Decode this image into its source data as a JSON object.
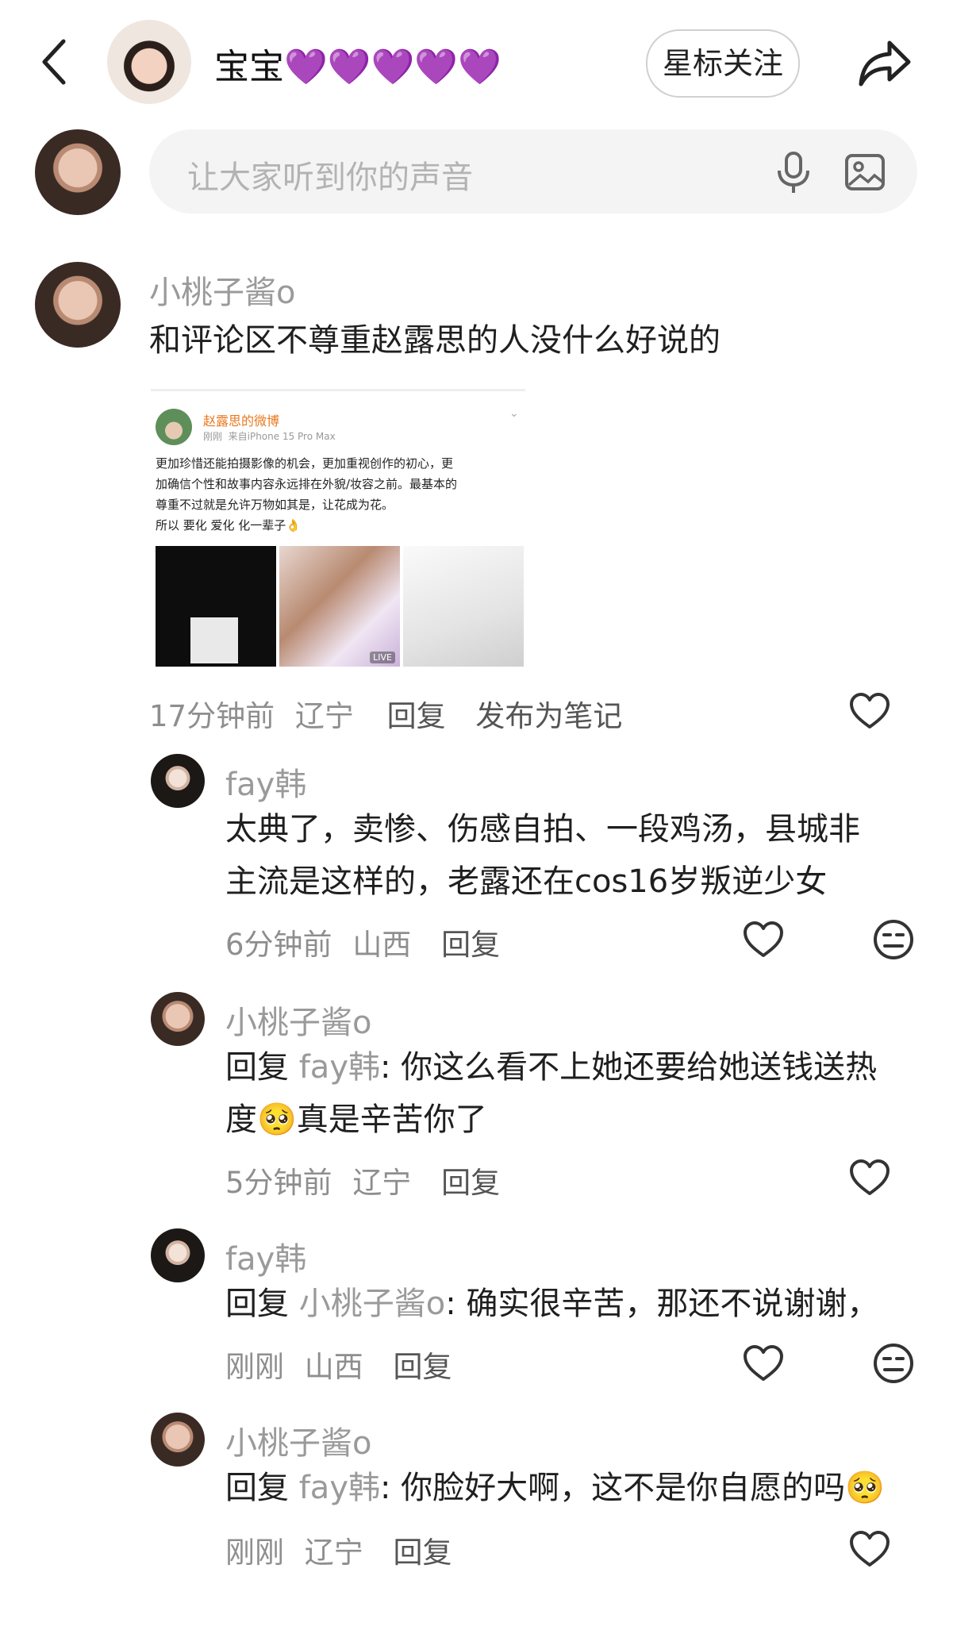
{
  "header": {
    "back_icon": "chevron-left-icon",
    "title": "宝宝💜💜💜💜💜",
    "follow_button": "星标关注",
    "share_icon": "share-arrow-icon"
  },
  "composer": {
    "placeholder": "让大家听到你的声音",
    "mic_icon": "microphone-icon",
    "image_icon": "image-icon"
  },
  "post": {
    "author": "小桃子酱o",
    "text": "和评论区不尊重赵露思的人没什么好说的",
    "screenshot": {
      "weibo_name": "赵露思的微博",
      "weibo_meta": "刚刚  来自iPhone 15 Pro Max",
      "weibo_line1": "更加珍惜还能拍摄影像的机会，更加重视创作的初心，更",
      "weibo_line2": "加确信个性和故事内容永远排在外貌/妆容之前。最基本的",
      "weibo_line3": "尊重不过就是允许万物如其是，让花成为花。",
      "weibo_line4": "所以 要化 爱化 化一辈子👌",
      "live_label": "LIVE"
    },
    "meta_time": "17分钟前",
    "meta_location": "辽宁",
    "reply_label": "回复",
    "publish_label": "发布为笔记"
  },
  "replies": [
    {
      "author": "fay韩",
      "text_line1": "太典了，卖惨、伤感自拍、一段鸡汤，县城非",
      "text_line2": "主流是这样的，老露还在cos16岁叛逆少女",
      "time": "6分钟前",
      "location": "山西",
      "reply_label": "回复"
    },
    {
      "author": "小桃子酱o",
      "prefix": "回复",
      "target": "fay韩",
      "text_line1": ": 你这么看不上她还要给她送钱送热",
      "text_line2": "度🥺真是辛苦你了",
      "time": "5分钟前",
      "location": "辽宁",
      "reply_label": "回复"
    },
    {
      "author": "fay韩",
      "prefix": "回复",
      "target": "小桃子酱o",
      "text_line1": ": 确实很辛苦，那还不说谢谢，",
      "time": "刚刚",
      "location": "山西",
      "reply_label": "回复"
    },
    {
      "author": "小桃子酱o",
      "prefix": "回复",
      "target": "fay韩",
      "text_line1": ": 你脸好大啊，这不是你自愿的吗🥺",
      "time": "刚刚",
      "location": "辽宁",
      "reply_label": "回复"
    }
  ],
  "icons": {
    "like": "heart-outline-icon",
    "dislike": "neutral-face-icon"
  },
  "colors": {
    "follow_border": "#d0d0d0",
    "composer_bg": "#f4f4f4",
    "muted_text": "#9a9a9a",
    "weibo_orange": "#e8791e"
  }
}
